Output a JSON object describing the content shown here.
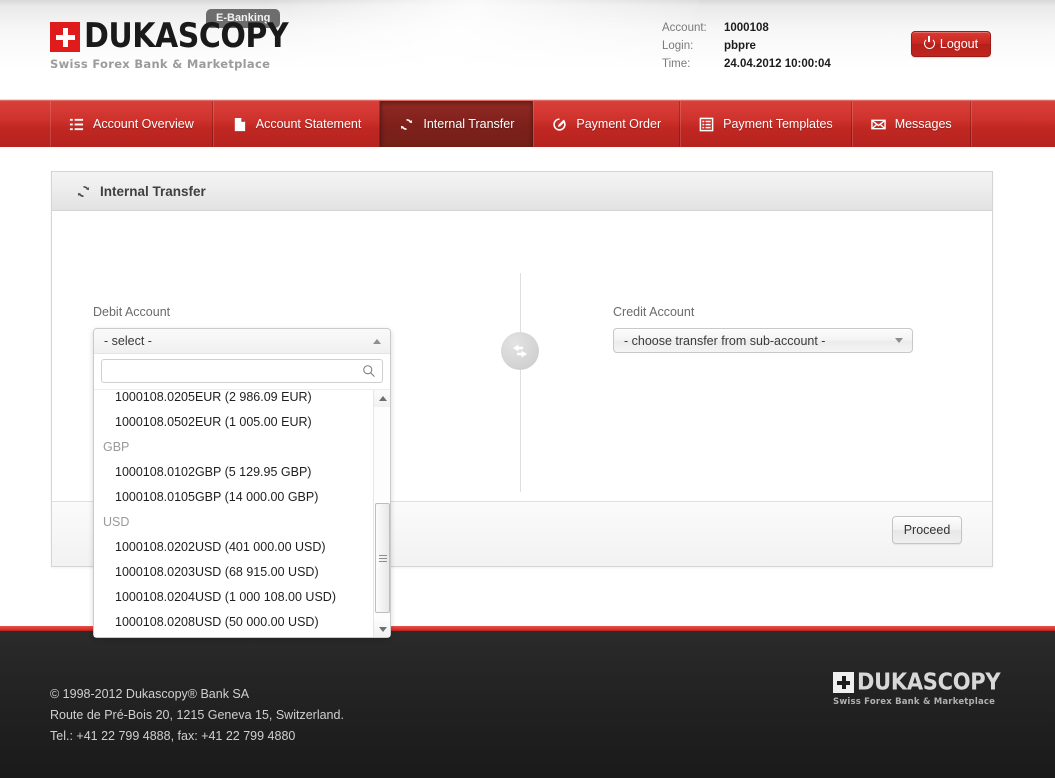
{
  "header": {
    "brand_name": "DUKASCOPY",
    "brand_tagline": "Swiss Forex Bank & Marketplace",
    "badge": "E-Banking",
    "account_label": "Account:",
    "account_value": "1000108",
    "login_label": "Login:",
    "login_value": "pbpre",
    "time_label": "Time:",
    "time_value": "24.04.2012 10:00:04",
    "logout_label": "Logout",
    "accent_red": "#c72620"
  },
  "nav": {
    "items": [
      {
        "label": "Account Overview",
        "icon": "list-icon",
        "active": false
      },
      {
        "label": "Account Statement",
        "icon": "document-icon",
        "active": false
      },
      {
        "label": "Internal Transfer",
        "icon": "refresh-icon",
        "active": true
      },
      {
        "label": "Payment Order",
        "icon": "edit-icon",
        "active": false
      },
      {
        "label": "Payment Templates",
        "icon": "grid-list-icon",
        "active": false
      },
      {
        "label": "Messages",
        "icon": "envelope-icon",
        "active": false
      }
    ]
  },
  "panel": {
    "title": "Internal Transfer",
    "title_icon": "refresh-icon",
    "proceed_label": "Proceed",
    "swap_icon": "swap-arrows-icon"
  },
  "debit": {
    "label": "Debit Account",
    "selected_text": "- select -",
    "expanded": true,
    "search_value": "",
    "search_placeholder": "",
    "search_icon": "search-icon",
    "options": [
      {
        "type": "option",
        "text": "1000108.0205EUR (2 986.09 EUR)"
      },
      {
        "type": "option",
        "text": "1000108.0502EUR (1 005.00 EUR)"
      },
      {
        "type": "group",
        "text": "GBP"
      },
      {
        "type": "option",
        "text": "1000108.0102GBP (5 129.95 GBP)"
      },
      {
        "type": "option",
        "text": "1000108.0105GBP (14 000.00 GBP)"
      },
      {
        "type": "group",
        "text": "USD"
      },
      {
        "type": "option",
        "text": "1000108.0202USD (401 000.00 USD)"
      },
      {
        "type": "option",
        "text": "1000108.0203USD (68 915.00 USD)"
      },
      {
        "type": "option",
        "text": "1000108.0204USD (1 000 108.00 USD)"
      },
      {
        "type": "option",
        "text": "1000108.0208USD (50 000.00 USD)"
      }
    ]
  },
  "credit": {
    "label": "Credit Account",
    "selected_text": "- choose transfer from sub-account -",
    "expanded": false
  },
  "footer": {
    "copyright": "© 1998-2012 Dukascopy® Bank SA",
    "address": "Route de Pré-Bois 20, 1215 Geneva 15, Switzerland.",
    "phone": "Tel.: +41 22 799 4888, fax: +41 22 799 4880",
    "brand_name": "DUKASCOPY",
    "brand_tagline": "Swiss Forex Bank & Marketplace"
  }
}
